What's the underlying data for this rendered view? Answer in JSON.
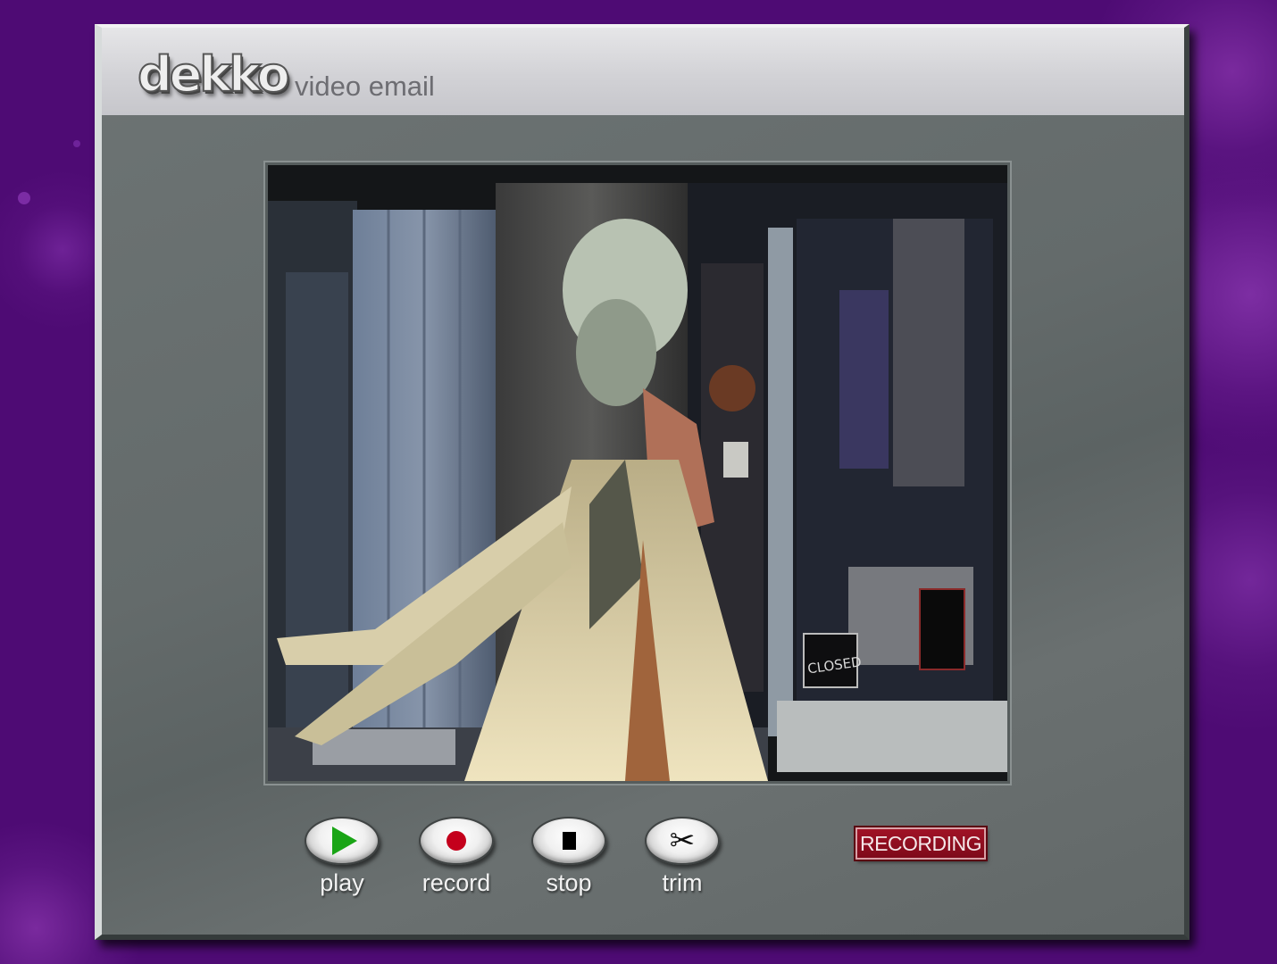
{
  "app": {
    "logo_text": "dekko",
    "subtitle": "video email"
  },
  "video": {
    "description_icon": "video-preview"
  },
  "controls": [
    {
      "id": "play",
      "label": "play",
      "icon": "play-icon",
      "color": "#1aa516"
    },
    {
      "id": "record",
      "label": "record",
      "icon": "record-icon",
      "color": "#c4001c"
    },
    {
      "id": "stop",
      "label": "stop",
      "icon": "stop-icon",
      "color": "#000000"
    },
    {
      "id": "trim",
      "label": "trim",
      "icon": "scissors-icon",
      "color": "#111111"
    }
  ],
  "status": {
    "text": "RECORDING",
    "color": "#a01226"
  },
  "colors": {
    "background": "#4e0b74",
    "window": "#646b6b",
    "titlebar": "#d2d2d6"
  }
}
